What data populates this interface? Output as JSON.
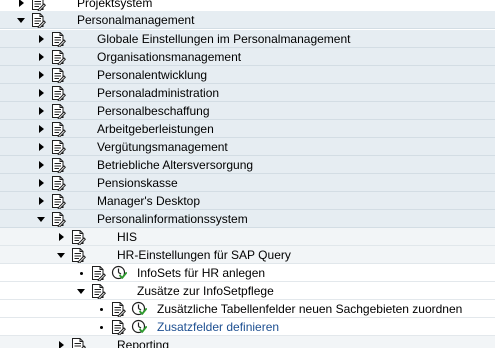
{
  "tree": {
    "nodes": [
      {
        "label": "Projektsystem",
        "state": "collapsed",
        "icons": [
          "structure-node-icon"
        ]
      },
      {
        "label": "Personalmanagement",
        "state": "expanded",
        "icons": [
          "structure-node-icon"
        ]
      },
      {
        "label": "Globale Einstellungen im Personalmanagement",
        "state": "collapsed",
        "icons": [
          "structure-node-icon"
        ]
      },
      {
        "label": "Organisationsmanagement",
        "state": "collapsed",
        "icons": [
          "structure-node-icon"
        ]
      },
      {
        "label": "Personalentwicklung",
        "state": "collapsed",
        "icons": [
          "structure-node-icon"
        ]
      },
      {
        "label": "Personaladministration",
        "state": "collapsed",
        "icons": [
          "structure-node-icon"
        ]
      },
      {
        "label": "Personalbeschaffung",
        "state": "collapsed",
        "icons": [
          "structure-node-icon"
        ]
      },
      {
        "label": "Arbeitgeberleistungen",
        "state": "collapsed",
        "icons": [
          "structure-node-icon"
        ]
      },
      {
        "label": "Vergütungsmanagement",
        "state": "collapsed",
        "icons": [
          "structure-node-icon"
        ]
      },
      {
        "label": "Betriebliche Altersversorgung",
        "state": "collapsed",
        "icons": [
          "structure-node-icon"
        ]
      },
      {
        "label": "Pensionskasse",
        "state": "collapsed",
        "icons": [
          "structure-node-icon"
        ]
      },
      {
        "label": "Manager's Desktop",
        "state": "collapsed",
        "icons": [
          "structure-node-icon"
        ]
      },
      {
        "label": "Personalinformationssystem",
        "state": "expanded",
        "icons": [
          "structure-node-icon"
        ]
      },
      {
        "label": "HIS",
        "state": "collapsed",
        "icons": [
          "structure-node-icon"
        ]
      },
      {
        "label": "HR-Einstellungen für SAP Query",
        "state": "expanded",
        "icons": [
          "structure-node-icon"
        ]
      },
      {
        "label": "InfoSets für HR anlegen",
        "state": "leaf",
        "icons": [
          "document-icon",
          "execute-clock-icon"
        ]
      },
      {
        "label": "Zusätze zur InfoSetpflege",
        "state": "expanded",
        "icons": [
          "structure-node-icon"
        ]
      },
      {
        "label": "Zusätzliche Tabellenfelder neuen Sachgebieten zuordnen",
        "state": "leaf",
        "icons": [
          "document-icon",
          "execute-clock-icon"
        ]
      },
      {
        "label": "Zusatzfelder definieren",
        "state": "leaf",
        "icons": [
          "document-icon",
          "execute-clock-icon"
        ],
        "style": "link"
      },
      {
        "label": "Reporting",
        "state": "collapsed",
        "icons": [
          "structure-node-icon"
        ]
      }
    ]
  }
}
